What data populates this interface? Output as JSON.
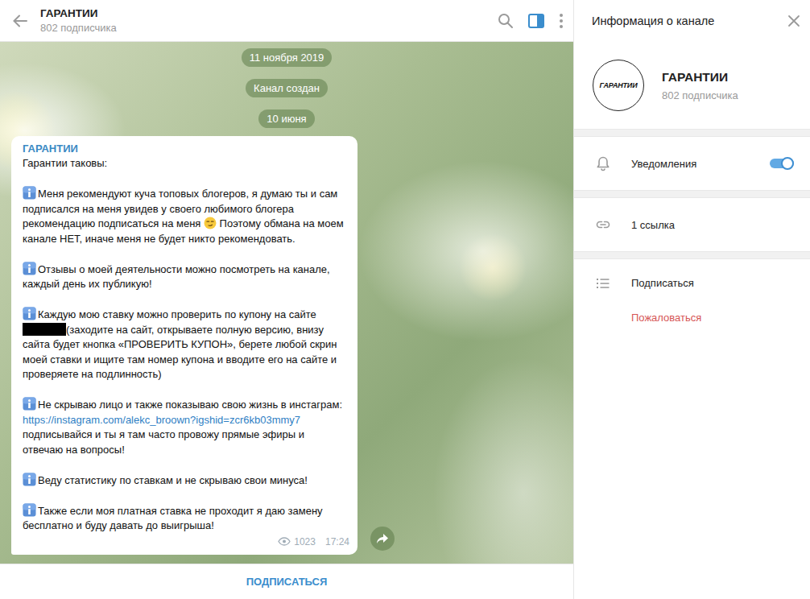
{
  "header": {
    "title": "ГАРАНТИИ",
    "subtitle": "802 подписчика",
    "sidebar_toggle_active": true
  },
  "service_messages": [
    {
      "text": "11 ноября 2019"
    },
    {
      "text": "Канал создан"
    },
    {
      "text": "10 июня"
    }
  ],
  "message": {
    "author": "ГАРАНТИИ",
    "intro": "Гарантии таковы:",
    "paragraphs": [
      [
        {
          "kind": "text",
          "text": "Меня рекомендуют куча топовых блогеров, я думаю ты и сам подписался на меня увидев у своего любимого блогера рекомендацию подписаться на меня "
        },
        {
          "kind": "emoji"
        },
        {
          "kind": "text",
          "text": " Поэтому обмана на моем канале НЕТ, иначе меня не будет никто рекомендовать."
        }
      ],
      [
        {
          "kind": "text",
          "text": "Отзывы о моей деятельности можно посмотреть на канале, каждый день их публикую!"
        }
      ],
      [
        {
          "kind": "text",
          "text": "Каждую мою ставку можно проверить по купону на сайте "
        },
        {
          "kind": "redacted"
        },
        {
          "kind": "text",
          "text": "(заходите на сайт, открываете полную версию, внизу сайта будет кнопка «ПРОВЕРИТЬ КУПОН», берете любой скрин моей ставки и ищите там номер купона и вводите его на сайте и проверяете на подлинность)"
        }
      ],
      [
        {
          "kind": "text",
          "text": "Не скрываю лицо и также показываю свою жизнь в инстаграм: "
        },
        {
          "kind": "link",
          "text": "https://instagram.com/alekc_broown?igshid=zcr6kb03mmy7"
        },
        {
          "kind": "text",
          "text": " подписывайся и ты я там часто провожу прямые эфиры и отвечаю на вопросы!"
        }
      ],
      [
        {
          "kind": "text",
          "text": "Веду статистику по ставкам и не скрываю свои минуса!"
        }
      ],
      [
        {
          "kind": "text",
          "text": "Также если моя платная ставка не проходит я даю замену бесплатно и буду давать до выигрыша!"
        }
      ]
    ],
    "views": "1023",
    "time": "17:24"
  },
  "footer": {
    "button": "ПОДПИСАТЬСЯ"
  },
  "info_panel": {
    "title": "Информация о канале",
    "avatar_text": "ГАРАНТИИ",
    "name": "ГАРАНТИИ",
    "subtitle": "802 подписчика",
    "notifications": {
      "label": "Уведомления",
      "on": true
    },
    "links": "1 ссылка",
    "actions": [
      {
        "label": "Подписаться",
        "danger": false
      },
      {
        "label": "Пожаловаться",
        "danger": true
      }
    ]
  }
}
